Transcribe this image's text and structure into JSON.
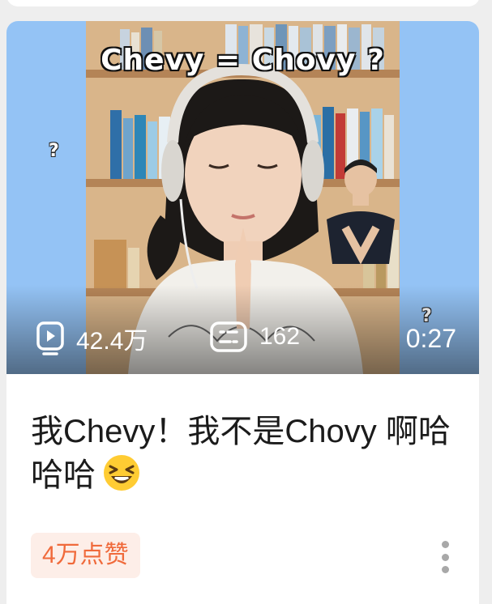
{
  "feed": {
    "card": {
      "thumbnail": {
        "overlay_title": "Chevy = Chovy ?",
        "question_marks": [
          "?",
          "?"
        ],
        "stats": {
          "play_icon": "play-video-icon",
          "play_count": "42.4万",
          "comment_icon": "danmaku-comment-icon",
          "comment_count": "162",
          "duration": "0:27"
        }
      },
      "title": "我Chevy！我不是Chovy 啊哈哈哈",
      "emoji_icon": "laughing-face-icon",
      "likes_badge": "4万点赞",
      "more_icon": "more-vertical-icon"
    }
  },
  "colors": {
    "thumbnail_bg": "#94c3f5",
    "badge_bg": "#fdeee8",
    "badge_text": "#f06a3b",
    "title_text": "#1b1b1b"
  }
}
